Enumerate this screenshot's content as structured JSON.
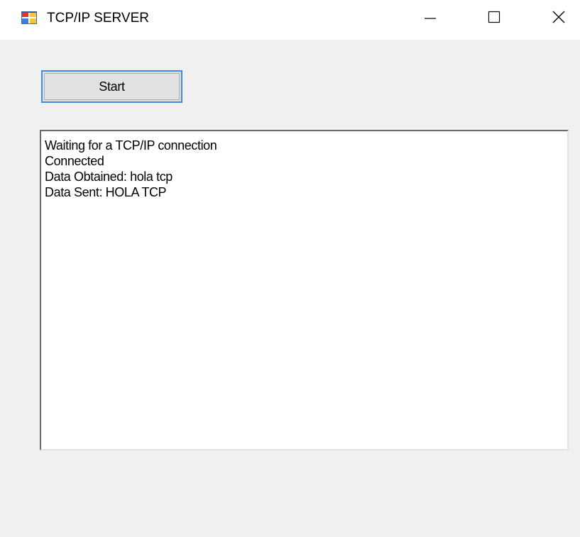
{
  "window": {
    "title": "TCP/IP SERVER",
    "app_icon": "winforms-app-icon",
    "controls": {
      "minimize": "minimize-icon",
      "maximize": "maximize-icon",
      "close": "close-icon"
    }
  },
  "toolbar": {
    "start_label": "Start"
  },
  "log": {
    "lines": [
      "Waiting for a TCP/IP connection",
      "Connected",
      "Data Obtained: hola tcp",
      "Data Sent: HOLA TCP"
    ]
  },
  "colors": {
    "focus_border": "#3c8de0",
    "button_face": "#e1e1e1",
    "window_bg": "#f0f0f0",
    "textbox_bg": "#ffffff"
  }
}
